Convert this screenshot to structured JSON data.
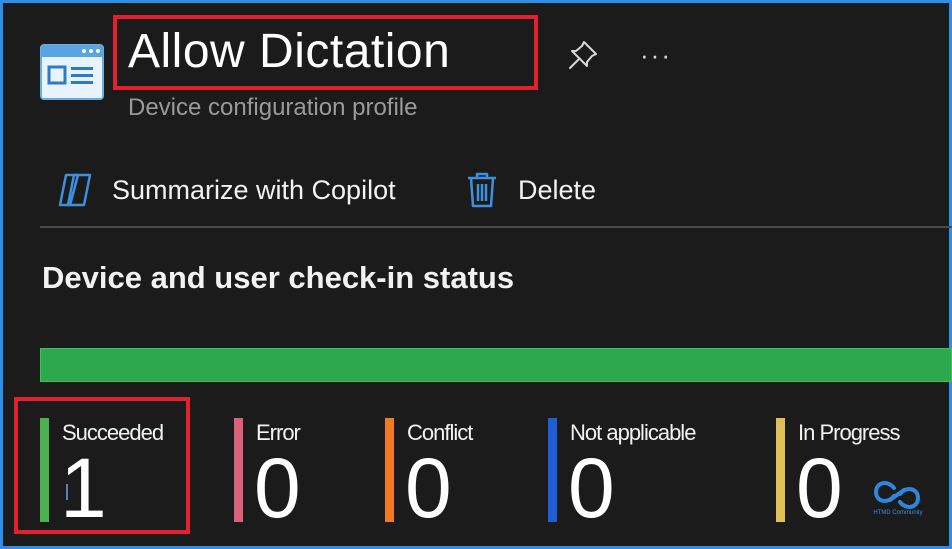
{
  "header": {
    "title": "Allow Dictation",
    "subtitle": "Device configuration profile",
    "icon": "profile-window-icon",
    "pin_icon": "pin-icon",
    "more_label": "···"
  },
  "toolbar": {
    "copilot_label": "Summarize with Copilot",
    "copilot_icon": "copilot-icon",
    "delete_label": "Delete",
    "delete_icon": "trash-icon"
  },
  "status": {
    "section_title": "Device and user check-in status",
    "progress_succeeded_fraction": 1.0,
    "items": [
      {
        "label": "Succeeded",
        "count": "1",
        "color": "#4caf50"
      },
      {
        "label": "Error",
        "count": "0",
        "color": "#d9617a"
      },
      {
        "label": "Conflict",
        "count": "0",
        "color": "#f07a21"
      },
      {
        "label": "Not applicable",
        "count": "0",
        "color": "#1e5fd8"
      },
      {
        "label": "In Progress",
        "count": "0",
        "color": "#e0bf55"
      }
    ]
  },
  "watermark": {
    "text": "HTMD Community"
  },
  "colors": {
    "highlight": "#e5202e",
    "accent": "#2f8fe8",
    "progress": "#2ea84c"
  }
}
